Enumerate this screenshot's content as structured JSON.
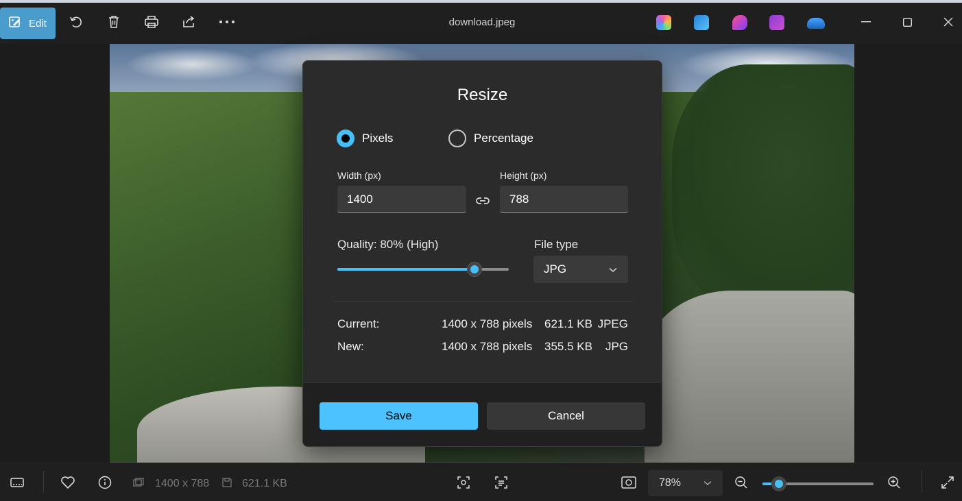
{
  "window": {
    "title": "download.jpeg"
  },
  "toolbar": {
    "edit_label": "Edit",
    "icons": [
      "edit-icon",
      "rotate-icon",
      "delete-icon",
      "print-icon",
      "share-icon",
      "more-icon"
    ]
  },
  "app_icons": [
    "copilot-icon",
    "designer-icon",
    "clipchamp-icon",
    "clipchamp-film-icon",
    "onedrive-icon"
  ],
  "dialog": {
    "title": "Resize",
    "mode_options": [
      {
        "label": "Pixels",
        "selected": true
      },
      {
        "label": "Percentage",
        "selected": false
      }
    ],
    "width_label": "Width  (px)",
    "width_value": "1400",
    "height_label": "Height  (px)",
    "height_value": "788",
    "quality_label": "Quality: 80% (High)",
    "quality_value": 0.8,
    "file_type_label": "File type",
    "file_type_value": "JPG",
    "current": {
      "label": "Current:",
      "dimensions": "1400 x 788 pixels",
      "size": "621.1 KB",
      "format": "JPEG"
    },
    "new": {
      "label": "New:",
      "dimensions": "1400 x 788 pixels",
      "size": "355.5 KB",
      "format": "JPG"
    },
    "save_label": "Save",
    "cancel_label": "Cancel"
  },
  "statusbar": {
    "dimensions": "1400 x 788",
    "filesize": "621.1 KB",
    "zoom": "78%",
    "zoom_fraction": 0.15
  },
  "colors": {
    "accent": "#4cc2ff",
    "edit_button": "#4a9ccc",
    "dialog_bg": "#2b2b2b",
    "app_bg": "#1c1c1c"
  }
}
